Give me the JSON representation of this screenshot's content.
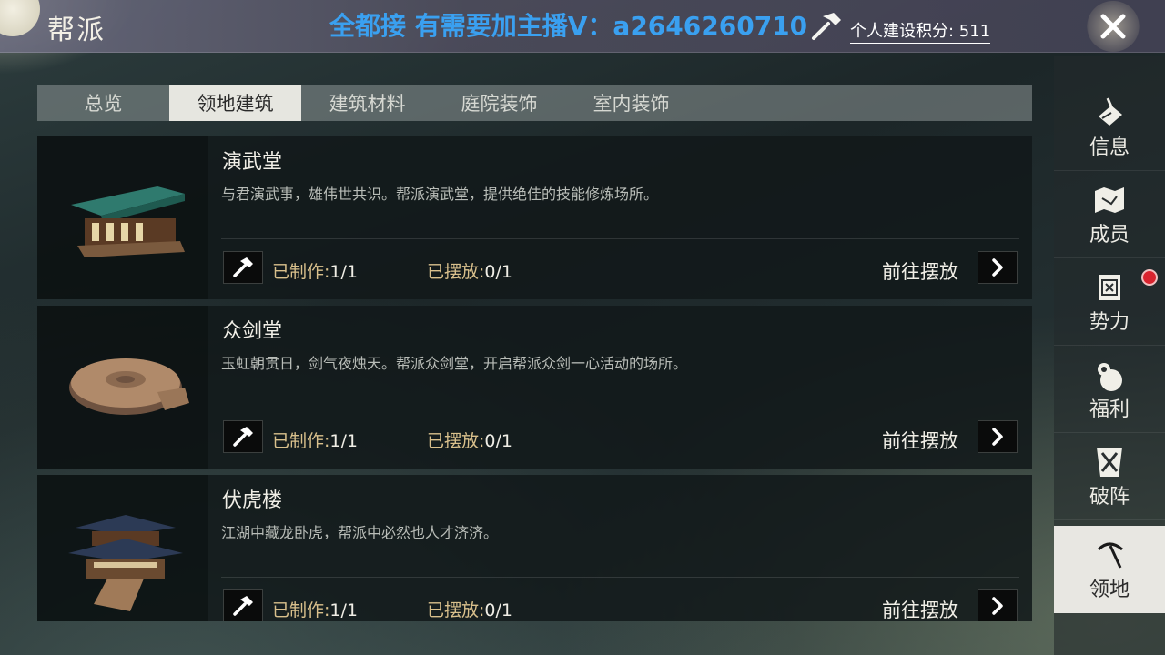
{
  "header": {
    "title": "帮派",
    "banner": "全都接 有需要加主播V：a2646260710",
    "points_label": "个人建设积分: 511",
    "close_icon": "close-icon"
  },
  "tabs": [
    {
      "label": "总览",
      "active": false
    },
    {
      "label": "领地建筑",
      "active": true
    },
    {
      "label": "建筑材料",
      "active": false
    },
    {
      "label": "庭院装饰",
      "active": false
    },
    {
      "label": "室内装饰",
      "active": false
    }
  ],
  "buildings": [
    {
      "name": "演武堂",
      "desc": "与君演武事，雄伟世共识。帮派演武堂，提供绝佳的技能修炼场所。",
      "made_label": "已制作:",
      "made_value": "1/1",
      "placed_label": "已摆放:",
      "placed_value": "0/1",
      "goto_label": "前往摆放"
    },
    {
      "name": "众剑堂",
      "desc": "玉虹朝贯日，剑气夜烛天。帮派众剑堂，开启帮派众剑一心活动的场所。",
      "made_label": "已制作:",
      "made_value": "1/1",
      "placed_label": "已摆放:",
      "placed_value": "0/1",
      "goto_label": "前往摆放"
    },
    {
      "name": "伏虎楼",
      "desc": "江湖中藏龙卧虎，帮派中必然也人才济济。",
      "made_label": "已制作:",
      "made_value": "1/1",
      "placed_label": "已摆放:",
      "placed_value": "0/1",
      "goto_label": "前往摆放"
    }
  ],
  "sidebar": [
    {
      "label": "信息",
      "icon": "scroll-icon",
      "active": false,
      "badge": false
    },
    {
      "label": "成员",
      "icon": "map-icon",
      "active": false,
      "badge": false
    },
    {
      "label": "势力",
      "icon": "banner-icon",
      "active": false,
      "badge": true
    },
    {
      "label": "福利",
      "icon": "money-bag-icon",
      "active": false,
      "badge": false
    },
    {
      "label": "破阵",
      "icon": "crossed-swords-icon",
      "active": false,
      "badge": false
    },
    {
      "label": "领地",
      "icon": "pickaxe-icon",
      "active": true,
      "badge": false
    }
  ],
  "colors": {
    "banner": "#3aa0f0",
    "label_gold": "#d9c08c",
    "badge_red": "#d8232e"
  }
}
